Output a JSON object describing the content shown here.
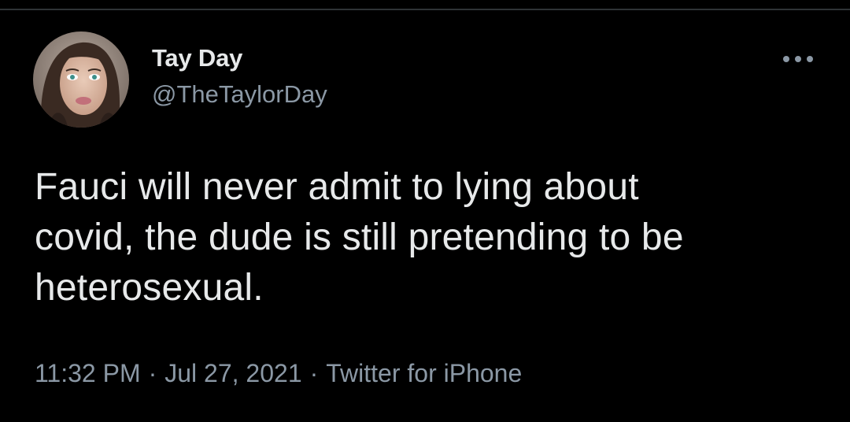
{
  "tweet": {
    "author": {
      "display_name": "Tay Day",
      "handle": "@TheTaylorDay",
      "avatar_icon": "profile-photo"
    },
    "more_icon": "more-horizontal-icon",
    "text": "Fauci will never admit to lying about\ncovid, the dude is still pretending to be\nheterosexual.",
    "time": "11:32 PM",
    "separator": "·",
    "date": "Jul 27, 2021",
    "source": "Twitter for iPhone"
  },
  "colors": {
    "background": "#000000",
    "primary_text": "#e7e9ea",
    "secondary_text": "#8b98a5",
    "divider": "#2f3336"
  }
}
